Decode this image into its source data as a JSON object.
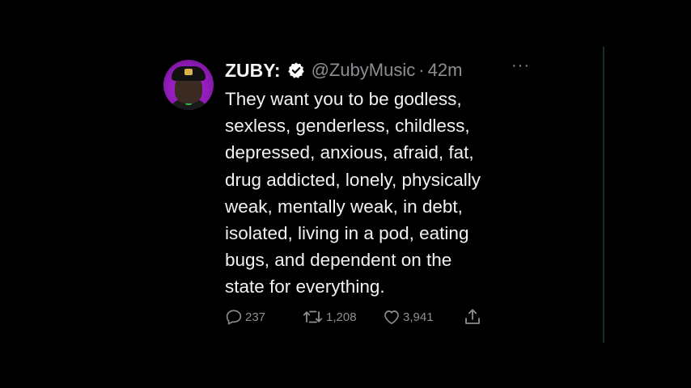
{
  "tweet": {
    "display_name": "ZUBY:",
    "handle": "@ZubyMusic",
    "separator": "·",
    "time": "42m",
    "more": "···",
    "body_lines": [
      "They want you to be godless,",
      "sexless, genderless, childless,",
      "depressed, anxious, afraid, fat,",
      "drug addicted, lonely, physically",
      "weak, mentally weak, in debt,",
      "isolated, living in a pod, eating",
      "bugs, and dependent on the",
      "state for everything."
    ],
    "stats": {
      "replies": "237",
      "retweets": "1,208",
      "likes": "3,941"
    }
  },
  "colors": {
    "background": "#000000",
    "text": "#f2f2f2",
    "muted": "#8b8f93",
    "avatar_ring": "#9d22c8",
    "divider": "#16331c"
  },
  "icons": {
    "verified": "verified-badge-icon",
    "more": "more-options-icon",
    "reply": "reply-icon",
    "retweet": "retweet-icon",
    "like": "heart-icon",
    "share": "share-icon"
  }
}
